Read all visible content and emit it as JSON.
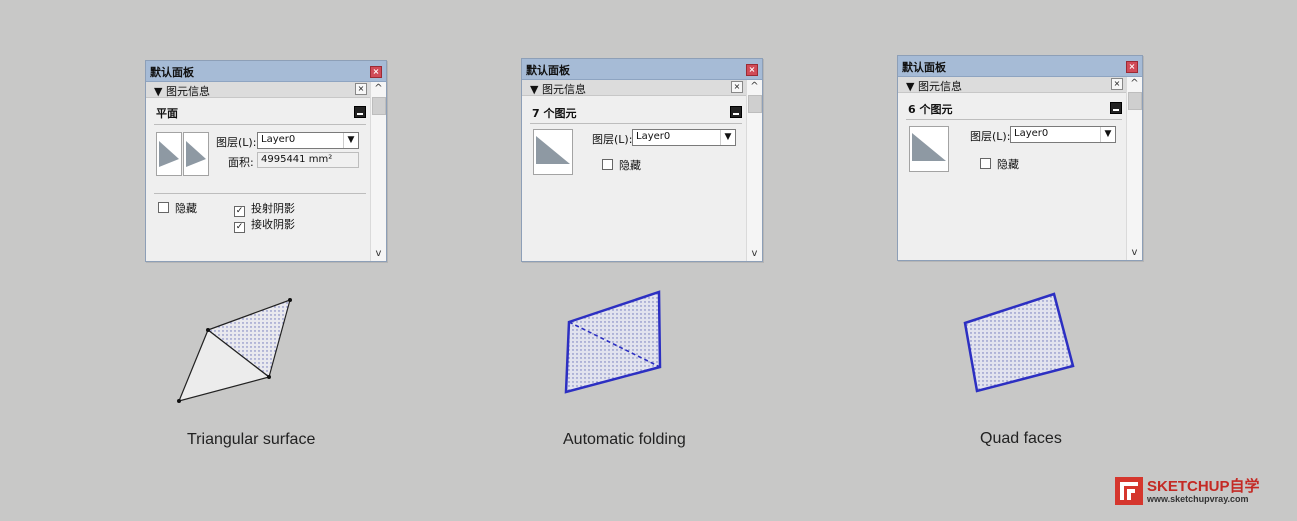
{
  "panels": [
    {
      "title": "默认面板",
      "close": "×",
      "section": "▼ 图元信息",
      "section_close": "×",
      "entity_type": "平面",
      "layer_label": "图层(L):",
      "layer_value": "Layer0",
      "area_label": "面积:",
      "area_value": "4995441 mm²",
      "hidden_label": "隐藏",
      "cast_shadow_label": "投射阴影",
      "receive_shadow_label": "接收阴影",
      "hidden_checked": false,
      "cast_shadow_checked": true,
      "receive_shadow_checked": true
    },
    {
      "title": "默认面板",
      "close": "×",
      "section": "▼ 图元信息",
      "section_close": "×",
      "entity_type": "7 个图元",
      "layer_label": "图层(L):",
      "layer_value": "Layer0",
      "hidden_label": "隐藏",
      "hidden_checked": false
    },
    {
      "title": "默认面板",
      "close": "×",
      "section": "▼ 图元信息",
      "section_close": "×",
      "entity_type": "6 个图元",
      "layer_label": "图层(L):",
      "layer_value": "Layer0",
      "hidden_label": "隐藏",
      "hidden_checked": false
    }
  ],
  "scrollbar": {
    "up": "^",
    "down": "v"
  },
  "dropdown_arrow": "▼",
  "captions": [
    "Triangular surface",
    "Automatic folding",
    "Quad faces"
  ],
  "logo": {
    "brand": "SKETCHUP自学",
    "url": "www.sketchupvray.com"
  },
  "colors": {
    "background": "#c8c8c7",
    "titlebar": "#a6bbd6",
    "close_red": "#d14b58",
    "selection_blue": "#2c2fc2",
    "logo_red": "#d5362d"
  }
}
